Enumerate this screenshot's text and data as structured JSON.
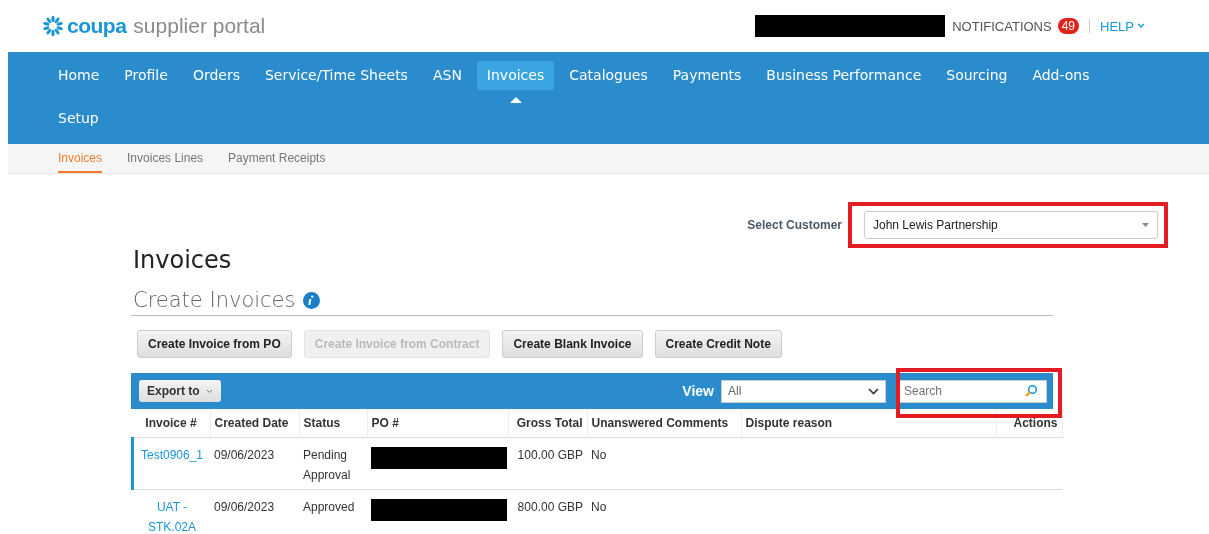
{
  "header": {
    "logo_brand": "coupa",
    "logo_product": "supplier portal",
    "account_redacted": true,
    "notifications": "NOTIFICATIONS",
    "notification_count": "49",
    "help": "HELP"
  },
  "nav": [
    {
      "label": "Home",
      "selected": false
    },
    {
      "label": "Profile",
      "selected": false
    },
    {
      "label": "Orders",
      "selected": false
    },
    {
      "label": "Service/Time Sheets",
      "selected": false
    },
    {
      "label": "ASN",
      "selected": false
    },
    {
      "label": "Invoices",
      "selected": true
    },
    {
      "label": "Catalogues",
      "selected": false
    },
    {
      "label": "Payments",
      "selected": false
    },
    {
      "label": "Business Performance",
      "selected": false
    },
    {
      "label": "Sourcing",
      "selected": false
    },
    {
      "label": "Add-ons",
      "selected": false
    },
    {
      "label": "Setup",
      "selected": false
    }
  ],
  "subnav": [
    {
      "label": "Invoices",
      "selected": true
    },
    {
      "label": "Invoices Lines",
      "selected": false
    },
    {
      "label": "Payment Receipts",
      "selected": false
    }
  ],
  "customer_select": {
    "label": "Select Customer",
    "value": "John Lewis Partnership",
    "highlighted": true
  },
  "title": "Invoices",
  "section_title": "Create Invoices",
  "create_buttons": [
    {
      "label": "Create Invoice from PO",
      "disabled": false
    },
    {
      "label": "Create Invoice from Contract",
      "disabled": true
    },
    {
      "label": "Create Blank Invoice",
      "disabled": false
    },
    {
      "label": "Create Credit Note",
      "disabled": false
    }
  ],
  "toolbar": {
    "export": "Export to",
    "view_label": "View",
    "view_value": "All",
    "search_placeholder": "Search",
    "search_highlighted": true
  },
  "table": {
    "columns": [
      "Invoice #",
      "Created Date",
      "Status",
      "PO #",
      "Gross Total",
      "Unanswered Comments",
      "Dispute reason",
      "Actions"
    ],
    "rows": [
      {
        "invoice": "Test0906_1",
        "created": "09/06/2023",
        "status": "Pending Approval",
        "po_redacted": true,
        "gross": "100.00 GBP",
        "unanswered": "No",
        "selected": true
      },
      {
        "invoice": "UAT - STK.02A",
        "created": "09/06/2023",
        "status": "Approved",
        "po_redacted": true,
        "gross": "800.00 GBP",
        "unanswered": "No",
        "selected": false
      }
    ]
  }
}
